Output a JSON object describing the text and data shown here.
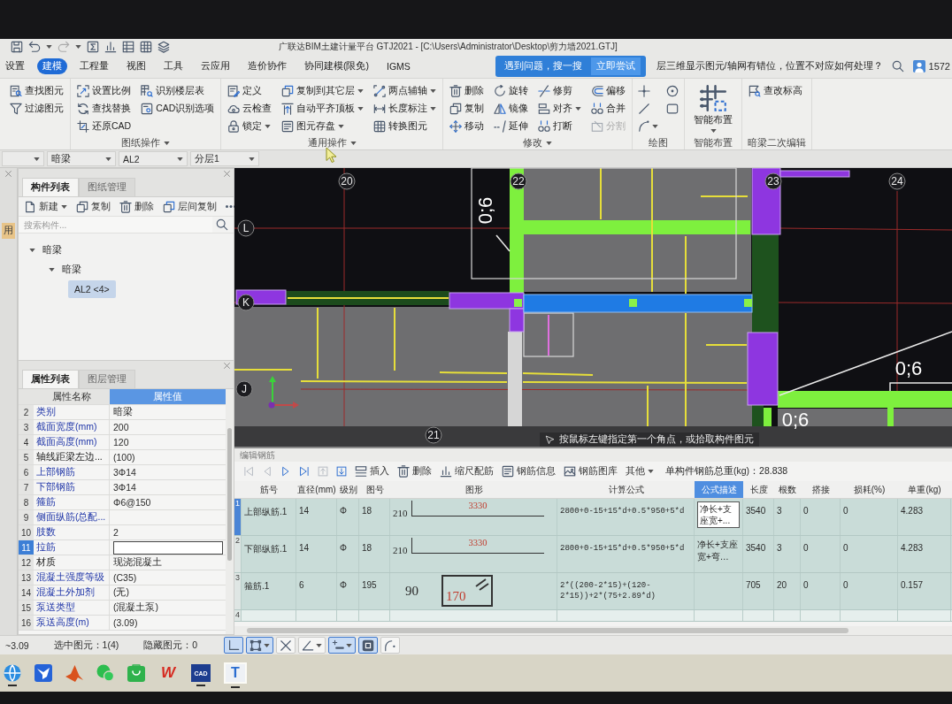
{
  "window": {
    "title": "广联达BIM土建计量平台 GTJ2021 - [C:\\Users\\Administrator\\Desktop\\剪力墙2021.GTJ]"
  },
  "menu_tabs": [
    {
      "label": "设置",
      "selected": false
    },
    {
      "label": "建模",
      "selected": true
    },
    {
      "label": "工程量",
      "selected": false
    },
    {
      "label": "视图",
      "selected": false
    },
    {
      "label": "工具",
      "selected": false
    },
    {
      "label": "云应用",
      "selected": false
    },
    {
      "label": "造价协作",
      "selected": false
    },
    {
      "label": "协同建模(限免)",
      "selected": false
    },
    {
      "label": "IGMS",
      "selected": false
    }
  ],
  "help_search": {
    "tip": "遇到问题，搜一搜",
    "button": "立即尝试",
    "query": "层三维显示图元/轴网有错位，位置不对应如何处理？"
  },
  "account": {
    "id": "1572"
  },
  "ribbon": [
    {
      "kind": "small",
      "items": [
        {
          "label": "查找图元",
          "menu": false,
          "disabled": false
        },
        {
          "label": "过滤图元",
          "menu": false,
          "disabled": false
        }
      ]
    },
    {
      "kind": "small",
      "label": "图纸操作",
      "menu": true,
      "items": [
        {
          "label": "设置比例",
          "menu": false,
          "disabled": false
        },
        {
          "label": "查找替换",
          "menu": false,
          "disabled": false
        },
        {
          "label": "还原CAD",
          "menu": false,
          "disabled": false
        },
        {
          "label": "识别楼层表",
          "menu": false,
          "disabled": false
        },
        {
          "label": "CAD识别选项",
          "menu": false,
          "disabled": false
        }
      ]
    },
    {
      "kind": "small",
      "label": "通用操作",
      "menu": true,
      "items": [
        {
          "label": "定义",
          "menu": false,
          "disabled": false
        },
        {
          "label": "云检查",
          "menu": false,
          "disabled": false
        },
        {
          "label": "锁定",
          "menu": true,
          "disabled": false
        },
        {
          "label": "复制到其它层",
          "menu": true,
          "disabled": false
        },
        {
          "label": "自动平齐顶板",
          "menu": true,
          "disabled": false
        },
        {
          "label": "图元存盘",
          "menu": true,
          "disabled": false
        },
        {
          "label": "两点辅轴",
          "menu": true,
          "disabled": false
        },
        {
          "label": "长度标注",
          "menu": true,
          "disabled": false
        },
        {
          "label": "转换图元",
          "menu": false,
          "disabled": false
        }
      ]
    },
    {
      "kind": "small",
      "label": "修改",
      "menu": true,
      "items": [
        {
          "label": "删除",
          "menu": false,
          "disabled": false
        },
        {
          "label": "复制",
          "menu": false,
          "disabled": false
        },
        {
          "label": "移动",
          "menu": false,
          "disabled": false
        },
        {
          "label": "旋转",
          "menu": false,
          "disabled": false
        },
        {
          "label": "镜像",
          "menu": false,
          "disabled": false
        },
        {
          "label": "延伸",
          "menu": false,
          "disabled": false
        },
        {
          "label": "修剪",
          "menu": false,
          "disabled": false
        },
        {
          "label": "对齐",
          "menu": true,
          "disabled": false
        },
        {
          "label": "打断",
          "menu": false,
          "disabled": false
        },
        {
          "label": "偏移",
          "menu": false,
          "disabled": false
        },
        {
          "label": "合并",
          "menu": false,
          "disabled": false
        },
        {
          "label": "分割",
          "menu": false,
          "disabled": true
        }
      ]
    },
    {
      "kind": "draw",
      "label": "绘图",
      "menu": false
    },
    {
      "kind": "large",
      "label": "智能布置",
      "menu": false,
      "items": [
        {
          "label": "智能布置",
          "menu": true,
          "disabled": false
        }
      ]
    },
    {
      "kind": "small",
      "label": "暗梁二次编辑",
      "menu": false,
      "items": [
        {
          "label": "查改标高",
          "menu": false,
          "disabled": false
        }
      ]
    }
  ],
  "selectors": [
    "暗梁",
    "AL2",
    "分层1"
  ],
  "side_strip": {
    "tab": "用"
  },
  "component_panel": {
    "tabs": [
      {
        "label": "构件列表",
        "selected": true
      },
      {
        "label": "图纸管理",
        "selected": false
      }
    ],
    "toolbar": [
      {
        "label": "新建",
        "menu": true
      },
      {
        "label": "复制",
        "menu": false
      },
      {
        "label": "删除",
        "menu": false
      },
      {
        "label": "层间复制",
        "menu": false
      }
    ],
    "search": {
      "placeholder": "搜索构件..."
    },
    "tree": [
      {
        "label": "暗梁",
        "expanded": true,
        "selected": false,
        "children": [
          {
            "label": "暗梁",
            "expanded": true,
            "selected": false,
            "children": [
              {
                "label": "AL2 <4>",
                "selected": true
              }
            ]
          }
        ]
      }
    ]
  },
  "properties_panel": {
    "tabs": [
      {
        "label": "属性列表",
        "selected": true
      },
      {
        "label": "图层管理",
        "selected": false
      }
    ],
    "columns": [
      {
        "label": "属性名称",
        "highlighted": false
      },
      {
        "label": "属性值",
        "highlighted": true
      }
    ],
    "rows": [
      {
        "no": "2",
        "name": "类别",
        "value": "暗梁",
        "public": true,
        "selected": false
      },
      {
        "no": "3",
        "name": "截面宽度(mm)",
        "value": "200",
        "public": true,
        "selected": false
      },
      {
        "no": "4",
        "name": "截面高度(mm)",
        "value": "120",
        "public": true,
        "selected": false
      },
      {
        "no": "5",
        "name": "轴线距梁左边...",
        "value": "(100)",
        "public": false,
        "selected": false
      },
      {
        "no": "6",
        "name": "上部钢筋",
        "value": "3Φ14",
        "public": true,
        "selected": false
      },
      {
        "no": "7",
        "name": "下部钢筋",
        "value": "3Φ14",
        "public": true,
        "selected": false
      },
      {
        "no": "8",
        "name": "箍筋",
        "value": "Φ6@150",
        "public": true,
        "selected": false
      },
      {
        "no": "9",
        "name": "侧面纵筋(总配...",
        "public": true,
        "selected": false
      },
      {
        "no": "10",
        "name": "肢数",
        "value": "2",
        "public": true,
        "selected": false
      },
      {
        "no": "11",
        "name": "拉筋",
        "public": true,
        "selected": true
      },
      {
        "no": "12",
        "name": "材质",
        "value": "现浇混凝土",
        "public": false,
        "selected": false
      },
      {
        "no": "13",
        "name": "混凝土强度等级",
        "value": "(C35)",
        "public": true,
        "selected": false
      },
      {
        "no": "14",
        "name": "混凝土外加剂",
        "value": "(无)",
        "public": true,
        "selected": false
      },
      {
        "no": "15",
        "name": "泵送类型",
        "value": "(混凝土泵)",
        "public": true,
        "selected": false
      },
      {
        "no": "16",
        "name": "泵送高度(m)",
        "value": "(3.09)",
        "public": true,
        "selected": false
      }
    ]
  },
  "canvas": {
    "axis_labels": [
      "20",
      "22",
      "23",
      "24",
      "21",
      "L",
      "K",
      "J"
    ],
    "dimension_labels": [
      "0;6",
      "0;6",
      "0;6"
    ],
    "prompt": "按鼠标左键指定第一个角点，或拾取构件图元"
  },
  "rebar_editor": {
    "title": "编辑钢筋",
    "nav_buttons": [
      {
        "kind": "first",
        "disabled": true
      },
      {
        "kind": "previous",
        "disabled": true
      },
      {
        "kind": "next",
        "disabled": false
      },
      {
        "kind": "last",
        "disabled": false
      },
      {
        "kind": "up",
        "disabled": true
      },
      {
        "kind": "down",
        "disabled": false
      }
    ],
    "tools": [
      {
        "label": "插入",
        "menu": false
      },
      {
        "label": "删除",
        "menu": false
      },
      {
        "label": "缩尺配筋",
        "menu": false
      },
      {
        "label": "钢筋信息",
        "menu": false
      },
      {
        "label": "钢筋图库",
        "menu": false
      },
      {
        "label": "其他",
        "menu": true
      }
    ],
    "total_weight": "单构件钢筋总重(kg)：28.838",
    "columns": [
      {
        "label": "筋号",
        "highlighted": false
      },
      {
        "label": "直径(mm)",
        "highlighted": false
      },
      {
        "label": "级别",
        "highlighted": false
      },
      {
        "label": "图号",
        "highlighted": false
      },
      {
        "label": "图形",
        "highlighted": false
      },
      {
        "label": "计算公式",
        "highlighted": false
      },
      {
        "label": "公式描述",
        "highlighted": true
      },
      {
        "label": "长度",
        "highlighted": false
      },
      {
        "label": "根数",
        "highlighted": false
      },
      {
        "label": "搭接",
        "highlighted": false
      },
      {
        "label": "损耗(%)",
        "highlighted": false
      },
      {
        "label": "单重(kg)",
        "highlighted": false
      }
    ],
    "rows": [
      {
        "no": "1",
        "selected": true,
        "name": "上部纵筋.1",
        "diameter": "14",
        "grade": "Φ",
        "shape_no": "18",
        "shape": {
          "kind": "bent_bar",
          "side": "210",
          "length": "3330"
        },
        "formula": "2800+0-15+15*d+0.5*950+5*d",
        "description": "净长+支座宽+...",
        "length": "3540",
        "count": "3",
        "lap": "0",
        "loss": "0",
        "unit_weight": "4.283"
      },
      {
        "no": "2",
        "selected": false,
        "name": "下部纵筋.1",
        "diameter": "14",
        "grade": "Φ",
        "shape_no": "18",
        "shape": {
          "kind": "bent_bar",
          "side": "210",
          "length": "3330"
        },
        "formula": "2800+0-15+15*d+0.5*950+5*d",
        "description": "净长+支座宽+弯…",
        "length": "3540",
        "count": "3",
        "lap": "0",
        "loss": "0",
        "unit_weight": "4.283"
      },
      {
        "no": "3",
        "selected": false,
        "name": "箍筋.1",
        "diameter": "6",
        "grade": "Φ",
        "shape_no": "195",
        "shape": {
          "kind": "stirrup",
          "side": "90",
          "length": "170"
        },
        "formula": "2*((200-2*15)+(120-2*15))+2*(75+2.89*d)",
        "length": "705",
        "count": "20",
        "lap": "0",
        "loss": "0",
        "unit_weight": "0.157"
      },
      {
        "no": "4",
        "selected": false
      }
    ]
  },
  "status_bar": {
    "items": [
      "~3.09",
      "选中图元：1(4)",
      "隐藏图元：0"
    ],
    "snap_tools": [
      {
        "kind": "orthogonal",
        "on": true,
        "menu": false
      },
      {
        "kind": "rectangle",
        "on": true,
        "menu": true
      },
      {
        "kind": "cross",
        "on": false,
        "menu": false
      },
      {
        "kind": "angle",
        "on": false,
        "menu": true
      },
      {
        "kind": "offset",
        "on": true,
        "menu": true
      },
      {
        "kind": "fill",
        "on": true,
        "menu": false
      },
      {
        "kind": "arc",
        "on": false,
        "menu": false
      }
    ]
  },
  "taskbar": [
    {
      "kind": "globe",
      "running": true,
      "active": false
    },
    {
      "kind": "bird",
      "running": false,
      "active": false
    },
    {
      "kind": "peak",
      "running": false,
      "active": false
    },
    {
      "kind": "chat",
      "running": false,
      "active": false
    },
    {
      "kind": "bag",
      "running": false,
      "active": false
    },
    {
      "kind": "red_letter",
      "label": "W",
      "running": false,
      "active": false
    },
    {
      "kind": "dark_tile",
      "label": "CAD",
      "running": true,
      "active": false
    },
    {
      "kind": "light_tile",
      "label": "T",
      "running": true,
      "active": true
    }
  ]
}
